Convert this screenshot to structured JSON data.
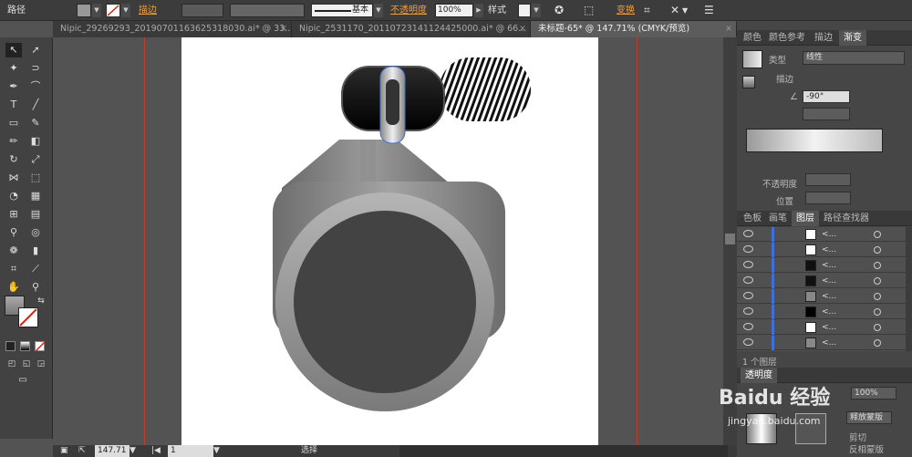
{
  "control_bar": {
    "object_type": "路径",
    "stroke_label": "描边",
    "stroke_profile": "基本",
    "opacity_label": "不透明度",
    "opacity_value": "100%",
    "style_label": "样式",
    "transform_label": "变换"
  },
  "tabs": [
    {
      "label": "Nipic_29269293_20190701163625318030.ai* @ 33...",
      "active": false
    },
    {
      "label": "Nipic_2531170_20110723141124425000.ai* @ 66...",
      "active": false
    },
    {
      "label": "未标题-65* @ 147.71% (CMYK/预览)",
      "active": true
    }
  ],
  "status_bar": {
    "zoom": "147.71",
    "artboard_num": "1",
    "tool_name": "选择"
  },
  "gradient_panel": {
    "tabs": [
      "颜色",
      "颜色参考",
      "描边",
      "渐变"
    ],
    "active_tab": "渐变",
    "type_label": "类型",
    "type_value": "线性",
    "stroke_label": "描边",
    "angle_value": "-90°",
    "opacity_label": "不透明度",
    "location_label": "位置"
  },
  "layers_panel": {
    "tabs": [
      "色板",
      "画笔",
      "图层",
      "路径查找器"
    ],
    "active_tab": "图层",
    "rows": [
      {
        "name": "<..."
      },
      {
        "name": "<..."
      },
      {
        "name": "<..."
      },
      {
        "name": "<..."
      },
      {
        "name": "<..."
      },
      {
        "name": "<..."
      },
      {
        "name": "<..."
      },
      {
        "name": "<..."
      }
    ],
    "layer_count": "1 个图层"
  },
  "transparency_panel": {
    "title": "透明度",
    "opacity_value": "100%",
    "release_mask": "释放蒙版",
    "clip_label": "剪切",
    "invert_mask": "反相蒙版"
  },
  "watermark_text": "Baidu 经验",
  "watermark_url": "jingyan.baidu.com",
  "colors": {
    "accent_orange": "#f29c38",
    "layer_blue": "#3f6fd8",
    "guide_red": "#c0392b"
  }
}
